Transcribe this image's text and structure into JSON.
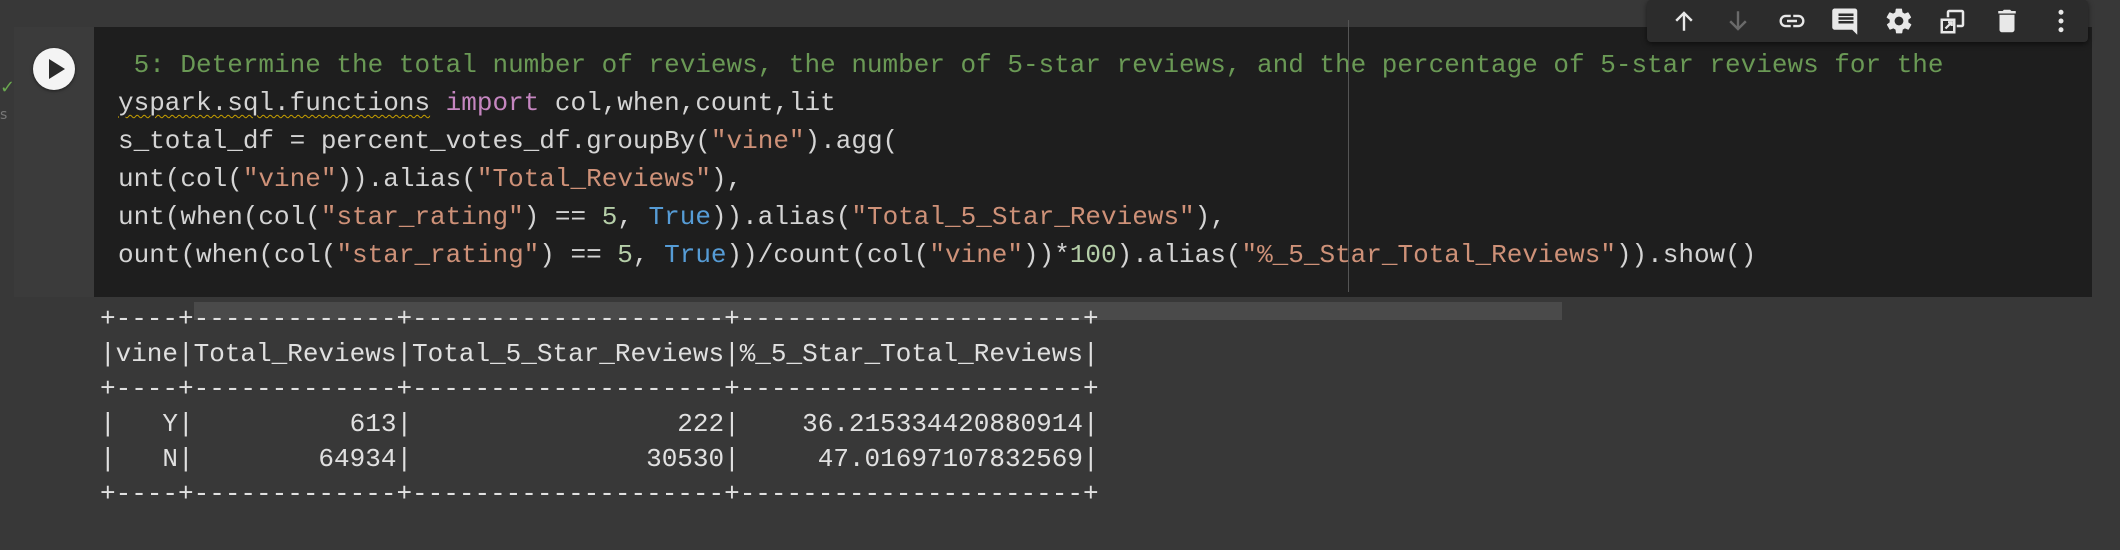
{
  "gutter": {
    "mark": "✓",
    "label": "s"
  },
  "toolbar": {
    "buttons": [
      {
        "name": "move-up",
        "icon": "arrow-up-icon"
      },
      {
        "name": "move-down",
        "icon": "arrow-down-icon"
      },
      {
        "name": "link",
        "icon": "link-icon"
      },
      {
        "name": "comment",
        "icon": "comment-icon"
      },
      {
        "name": "settings",
        "icon": "gear-icon"
      },
      {
        "name": "mirror",
        "icon": "mirror-cell-icon"
      },
      {
        "name": "delete",
        "icon": "trash-icon"
      },
      {
        "name": "more",
        "icon": "more-vert-icon"
      }
    ]
  },
  "code": {
    "lines": {
      "l1": " 5: Determine the total number of reviews, the number of 5-star reviews, and the percentage of 5-star reviews for the",
      "l2a": "yspark.sql.functions",
      "l2b": " ",
      "l2c": "import",
      "l2d": " col,when,count,lit",
      "l3a": "s_total_df = percent_votes_df.groupBy(",
      "l3b": "\"vine\"",
      "l3c": ").agg(",
      "l4a": "unt(col(",
      "l4b": "\"vine\"",
      "l4c": ")).alias(",
      "l4d": "\"Total_Reviews\"",
      "l4e": "),",
      "l5a": "unt(when(col(",
      "l5b": "\"star_rating\"",
      "l5c": ") == ",
      "l5d": "5",
      "l5e": ", ",
      "l5f": "True",
      "l5g": ")).alias(",
      "l5h": "\"Total_5_Star_Reviews\"",
      "l5i": "),",
      "l6a": "ount(when(col(",
      "l6b": "\"star_rating\"",
      "l6c": ") == ",
      "l6d": "5",
      "l6e": ", ",
      "l6f": "True",
      "l6g": "))/count(col(",
      "l6h": "\"vine\"",
      "l6i": "))*",
      "l6j": "100",
      "l6k": ").alias(",
      "l6l": "\"%_5_Star_Total_Reviews\"",
      "l6m": ")).show()"
    }
  },
  "output": {
    "border": "+----+-------------+--------------------+----------------------+",
    "header": "|vine|Total_Reviews|Total_5_Star_Reviews|%_5_Star_Total_Reviews|",
    "rows": [
      "|   Y|          613|                 222|    36.215334420880914|",
      "|   N|        64934|               30530|     47.01697107832569|"
    ]
  },
  "colors": {
    "comment": "#6a9955",
    "keyword": "#c586c0",
    "string": "#ce9178",
    "boolean": "#569cd6",
    "number": "#b5cea8"
  }
}
